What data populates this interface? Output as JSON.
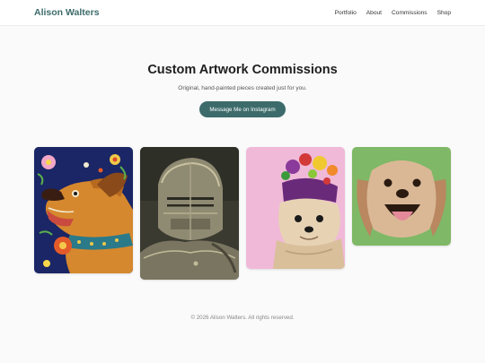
{
  "brand": {
    "name": "Alison Walters",
    "color": "#3d6b6b"
  },
  "nav": {
    "items": [
      {
        "label": "Portfolio"
      },
      {
        "label": "About"
      },
      {
        "label": "Commissions"
      },
      {
        "label": "Shop"
      }
    ]
  },
  "hero": {
    "title": "Custom Artwork Commissions",
    "subtitle": "Original, hand-painted pieces created just for you.",
    "cta_label": "Message Me on Instagram"
  },
  "gallery": {
    "items": [
      {
        "subject": "folk-art dog painting"
      },
      {
        "subject": "knight armor painting"
      },
      {
        "subject": "dog with fruit hat painting"
      },
      {
        "subject": "smiling spaniel painting"
      }
    ]
  },
  "footer": {
    "text": "© 2026 Alison Walters. All rights reserved."
  }
}
